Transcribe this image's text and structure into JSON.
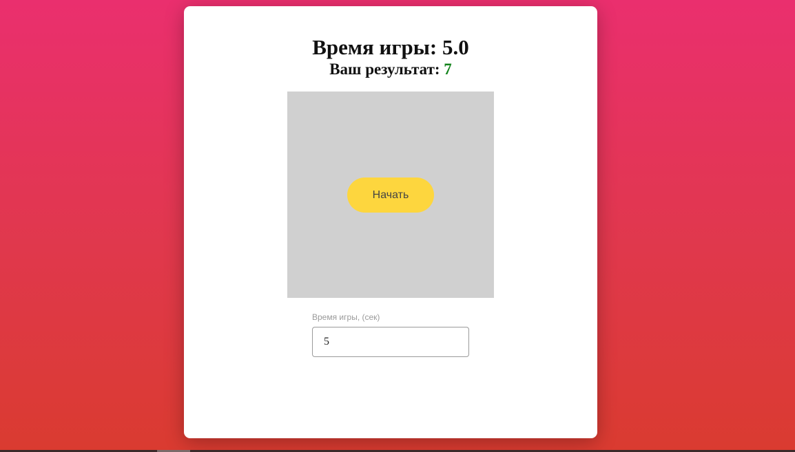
{
  "header": {
    "time_label": "Время игры:",
    "time_value": "5.0",
    "result_label": "Ваш результат:",
    "result_value": "7"
  },
  "game": {
    "start_label": "Начать"
  },
  "settings": {
    "time_field_label": "Время игры, (сек)",
    "time_field_value": "5"
  },
  "colors": {
    "background_top": "#ea2f6e",
    "background_bottom": "#da3b30",
    "start_button": "#fdd63e",
    "score": "#11821a",
    "game_area": "#d0d0d0"
  }
}
